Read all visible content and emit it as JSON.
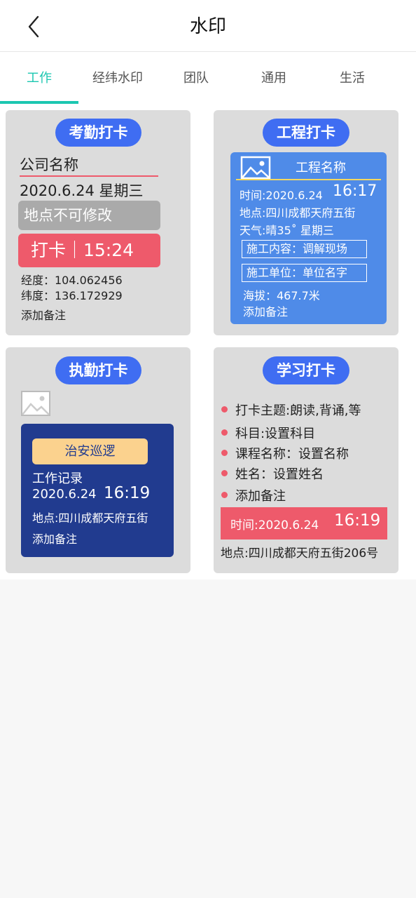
{
  "header": {
    "title": "水印"
  },
  "tabs": [
    {
      "label": "工作"
    },
    {
      "label": "经纬水印"
    },
    {
      "label": "团队"
    },
    {
      "label": "通用"
    },
    {
      "label": "生活"
    }
  ],
  "cards": {
    "kaoqin": {
      "pill": "考勤打卡",
      "company": "公司名称",
      "date": "2020.6.24  星期三",
      "location_locked": "地点不可修改",
      "punch": "打卡｜15:24",
      "longitude": "经度：104.062456",
      "latitude": "纬度：136.172929",
      "note": "添加备注"
    },
    "gongcheng": {
      "pill": "工程打卡",
      "project": "工程名称",
      "time_label": "时间:2020.6.24",
      "time_value": "16:17",
      "location": "地点:四川成都天府五街",
      "weather": "天气:晴35˚ 星期三",
      "content": "施工内容：调解现场",
      "unit": "施工单位：单位名字",
      "altitude": "海拔：467.7米",
      "note": "添加备注"
    },
    "zhiqin": {
      "pill": "执勤打卡",
      "badge": "治安巡逻",
      "record": "工作记录",
      "date": "2020.6.24",
      "time": "16:19",
      "location": "地点:四川成都天府五街",
      "note": "添加备注"
    },
    "xuexi": {
      "pill": "学习打卡",
      "items": [
        "打卡主题:朗读,背诵,等",
        "科目:设置科目",
        "课程名称：设置名称",
        "姓名：设置姓名",
        "添加备注"
      ],
      "time_label": "时间:2020.6.24",
      "time_value": "16:19",
      "location": "地点:四川成都天府五街206号"
    }
  },
  "colors": {
    "accent": "#1cc7b1",
    "pill": "#3f6df2",
    "red": "#ee5a6b",
    "blue": "#4f8be8",
    "navy": "#213b8f",
    "gray": "#aaaaaa",
    "orange": "#fbd28e"
  }
}
